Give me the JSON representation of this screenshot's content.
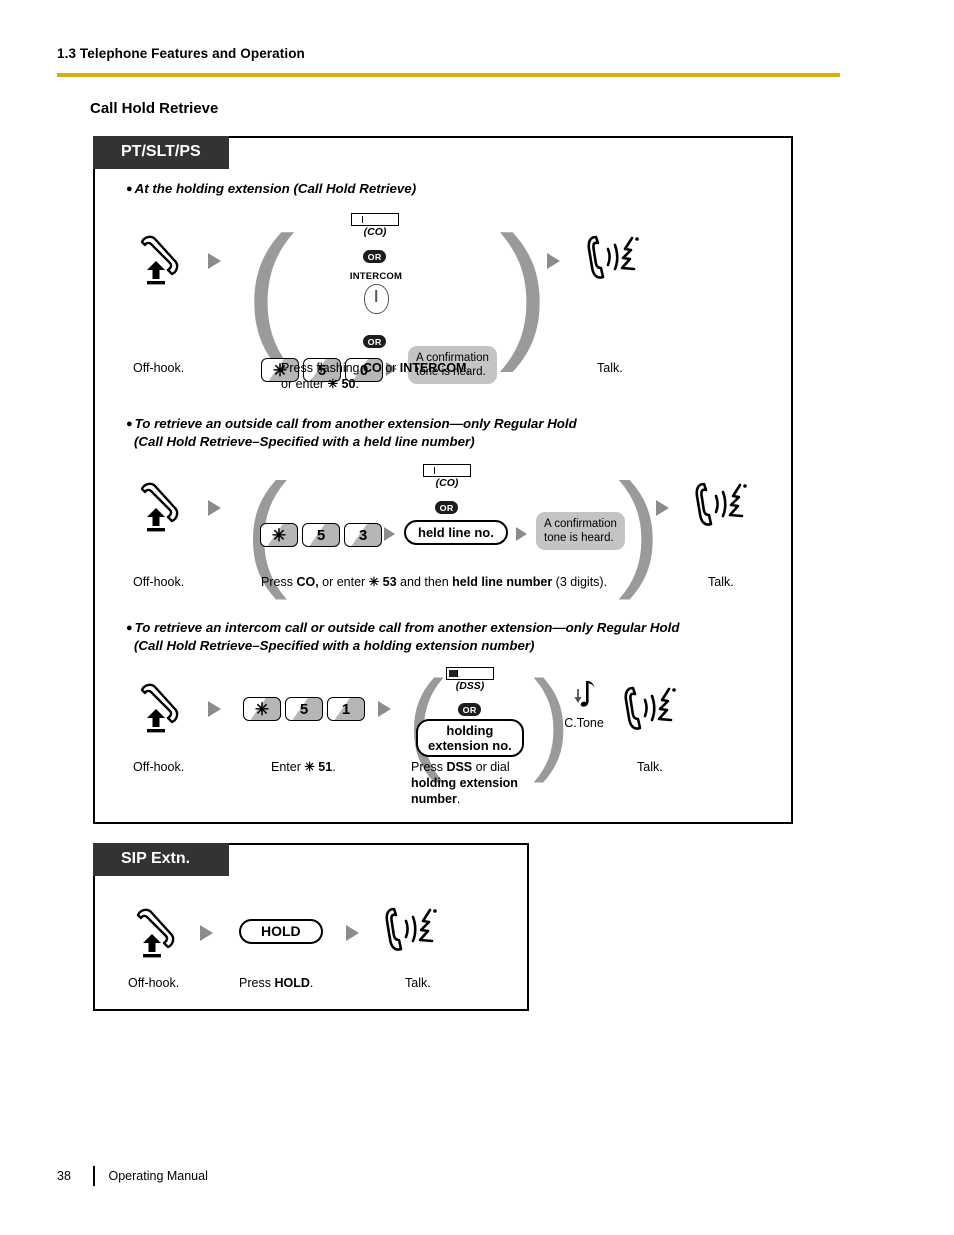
{
  "header": {
    "title": "1.3 Telephone Features and Operation",
    "rule_color": "#d8ad12"
  },
  "page": {
    "section_title": "Call Hold Retrieve"
  },
  "footer": {
    "page_number": "38",
    "manual_label": "Operating Manual"
  },
  "pt_box": {
    "tab_label": "PT/SLT/PS",
    "flows": [
      {
        "bullet_line1": "At the holding extension (Call Hold Retrieve)",
        "bullet_line2": "",
        "lamp_label": "(CO)",
        "or_label_1": "OR",
        "intercom_label": "INTERCOM",
        "or_label_2": "OR",
        "keys": [
          "✳",
          "5",
          "0"
        ],
        "note": {
          "line1": "A confirmation",
          "line2": "tone is heard."
        },
        "caption_left": "Off-hook.",
        "caption_mid_line1_a": "Press flashing ",
        "caption_mid_line1_b": "CO",
        "caption_mid_line1_c": " or ",
        "caption_mid_line1_d": "INTERCOM",
        "caption_mid_line1_e": ",",
        "caption_mid_line2_a": "or enter ",
        "caption_mid_line2_b": "✳ 50",
        "caption_mid_line2_c": ".",
        "caption_right": "Talk."
      },
      {
        "bullet_line1": "To retrieve an outside call from another extension—only Regular Hold",
        "bullet_line2": "(Call Hold Retrieve–Specified with a held line number)",
        "lamp_label": "(CO)",
        "or_label_1": "OR",
        "keys": [
          "✳",
          "5",
          "3"
        ],
        "pill_label": "held line no.",
        "note": {
          "line1": "A confirmation",
          "line2": "tone is heard."
        },
        "caption_left": "Off-hook.",
        "caption_mid_a": "Press ",
        "caption_mid_b": "CO,",
        "caption_mid_c": " or enter ",
        "caption_mid_d": "✳ 53",
        "caption_mid_e": " and then ",
        "caption_mid_f": "held line number",
        "caption_mid_g": " (3 digits).",
        "caption_right": "Talk."
      },
      {
        "bullet_line1": "To retrieve an intercom call or outside call from another extension—only Regular Hold",
        "bullet_line2": "(Call Hold Retrieve–Specified with a holding extension number)",
        "keys": [
          "✳",
          "5",
          "1"
        ],
        "lamp_label": "(DSS)",
        "or_label_1": "OR",
        "pill_line1": "holding",
        "pill_line2": "extension no.",
        "ctone_label": "C.Tone",
        "caption_left": "Off-hook.",
        "caption_mid_a": "Enter ",
        "caption_mid_b": "✳ 51",
        "caption_mid_c": ".",
        "caption_third_a": "Press ",
        "caption_third_b": "DSS",
        "caption_third_c": " or dial",
        "caption_third_d": "holding extension",
        "caption_third_e": "number",
        "caption_third_f": ".",
        "caption_right": "Talk."
      }
    ]
  },
  "sip_box": {
    "tab_label": "SIP Extn.",
    "hold_key_label": "HOLD",
    "caption_left": "Off-hook.",
    "caption_mid_a": "Press ",
    "caption_mid_b": "HOLD",
    "caption_mid_c": ".",
    "caption_right": "Talk."
  },
  "icons": {
    "offhook": "offhook-handset-icon",
    "talk": "talking-handset-icon",
    "arrow": "flow-arrow-icon",
    "ctone": "music-note-icon"
  }
}
